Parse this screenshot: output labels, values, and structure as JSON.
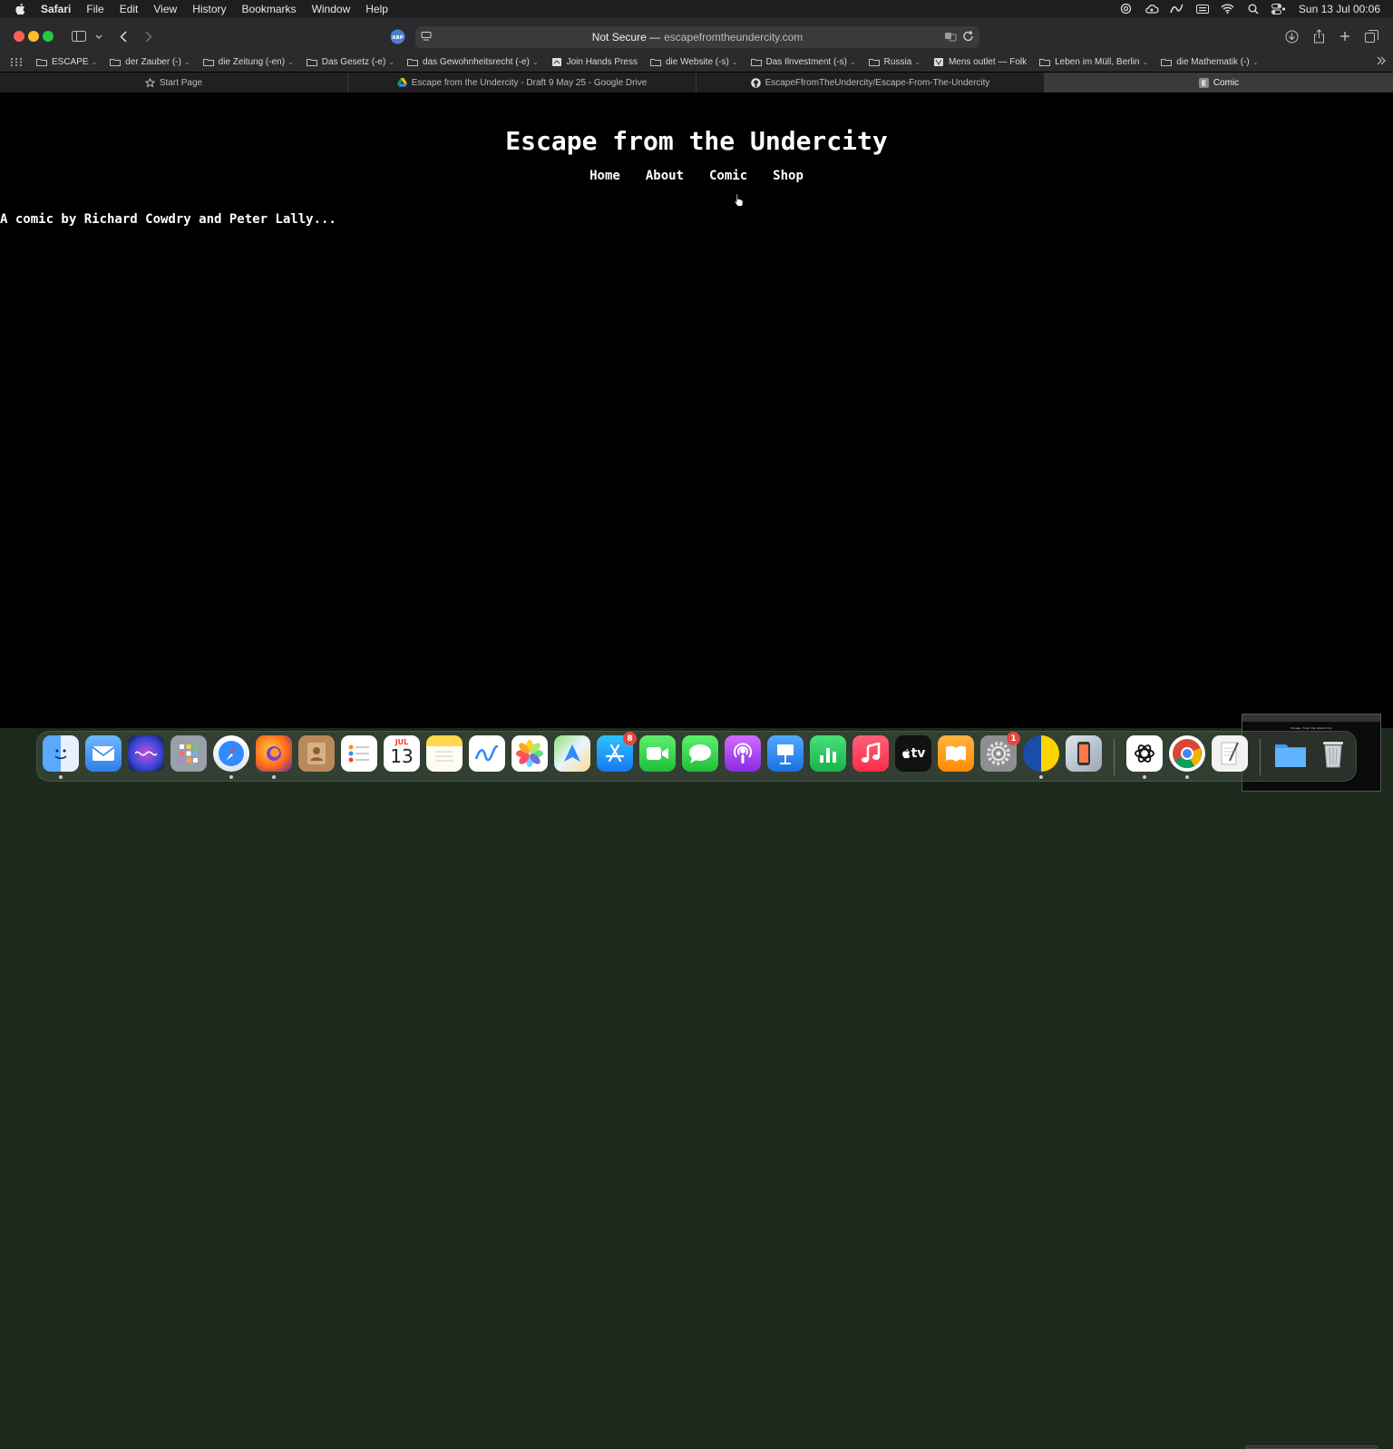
{
  "menubar": {
    "app": "Safari",
    "items": [
      "File",
      "Edit",
      "View",
      "History",
      "Bookmarks",
      "Window",
      "Help"
    ],
    "clock": "Sun 13 Jul  00:06"
  },
  "address": {
    "security": "Not Secure —",
    "url": "escapefromtheundercity.com"
  },
  "bookmarks": [
    {
      "label": "ESCAPE",
      "type": "folder"
    },
    {
      "label": "der Zauber (-)",
      "type": "folder"
    },
    {
      "label": "die Zeitung (-en)",
      "type": "folder"
    },
    {
      "label": "Das Gesetz (-e)",
      "type": "folder"
    },
    {
      "label": "das Gewohnheitsrecht (-e)",
      "type": "folder"
    },
    {
      "label": "Join Hands Press",
      "type": "link"
    },
    {
      "label": "die Website (-s)",
      "type": "folder"
    },
    {
      "label": "Das Ilnvestment (-s)",
      "type": "folder"
    },
    {
      "label": "Russia",
      "type": "folder"
    },
    {
      "label": "Mens outlet — Folk",
      "type": "link"
    },
    {
      "label": "Leben im Müll, Berlin",
      "type": "folder"
    },
    {
      "label": "die Mathematik (-)",
      "type": "folder"
    }
  ],
  "tabs": [
    {
      "label": "Start Page",
      "icon": "star-icon"
    },
    {
      "label": "Escape from the Undercity - Draft 9 May 25 - Google Drive",
      "icon": "google-drive-icon"
    },
    {
      "label": "EscapeFfromTheUndercity/Escape-From-The-Undercity",
      "icon": "github-icon"
    },
    {
      "label": "Comic",
      "icon": "site-e-icon",
      "active": true
    }
  ],
  "page": {
    "title": "Escape from the Undercity",
    "nav": [
      "Home",
      "About",
      "Comic",
      "Shop"
    ],
    "tagline": "A comic by Richard Cowdry and Peter Lally..."
  },
  "thumbnail": {
    "title": "Escape from the Undercity"
  },
  "dock": {
    "calendar_month": "JUL",
    "calendar_day": "13",
    "appstore_badge": "8",
    "settings_badge": "1",
    "tv_label": "tv"
  },
  "colors": {
    "page_bg": "#000000",
    "page_text": "#ffffff",
    "toolbar": "#2b2b2d",
    "badge": "#e8453c"
  }
}
